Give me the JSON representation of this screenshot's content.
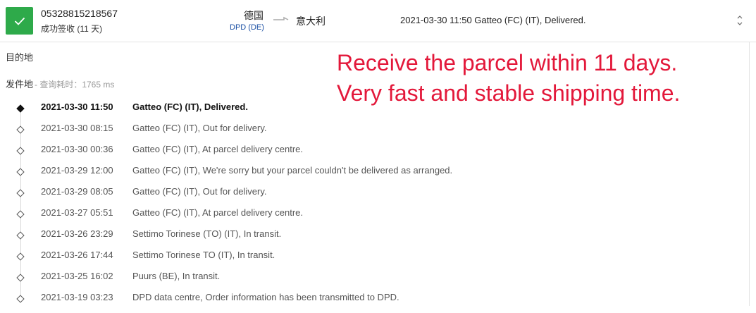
{
  "header": {
    "tracking_number": "05328815218567",
    "status_text": "成功签收 (11 天)",
    "status_icon": "checkmark-icon",
    "status_color": "#2eaa4a",
    "origin_country": "德国",
    "carrier": "DPD (DE)",
    "destination_country": "意大利",
    "latest_event": "2021-03-30 11:50  Gatteo (FC) (IT), Delivered."
  },
  "details": {
    "destination_label": "目的地",
    "origin_label": "发件地",
    "query_time": "- 查询耗时：1765 ms"
  },
  "annotation": {
    "line1": "Receive the parcel within 11 days.",
    "line2": "Very fast and stable shipping time.",
    "color": "#e3183a"
  },
  "events": [
    {
      "time": "2021-03-30 11:50",
      "desc": "Gatteo (FC) (IT), Delivered."
    },
    {
      "time": "2021-03-30 08:15",
      "desc": "Gatteo (FC) (IT), Out for delivery."
    },
    {
      "time": "2021-03-30 00:36",
      "desc": "Gatteo (FC) (IT), At parcel delivery centre."
    },
    {
      "time": "2021-03-29 12:00",
      "desc": "Gatteo (FC) (IT), We're sorry but your parcel couldn't be delivered as arranged."
    },
    {
      "time": "2021-03-29 08:05",
      "desc": "Gatteo (FC) (IT), Out for delivery."
    },
    {
      "time": "2021-03-27 05:51",
      "desc": "Gatteo (FC) (IT), At parcel delivery centre."
    },
    {
      "time": "2021-03-26 23:29",
      "desc": "Settimo Torinese (TO) (IT), In transit."
    },
    {
      "time": "2021-03-26 17:44",
      "desc": "Settimo Torinese TO (IT), In transit."
    },
    {
      "time": "2021-03-25 16:02",
      "desc": "Puurs (BE), In transit."
    },
    {
      "time": "2021-03-19 03:23",
      "desc": "DPD data centre, Order information has been transmitted to DPD."
    }
  ]
}
